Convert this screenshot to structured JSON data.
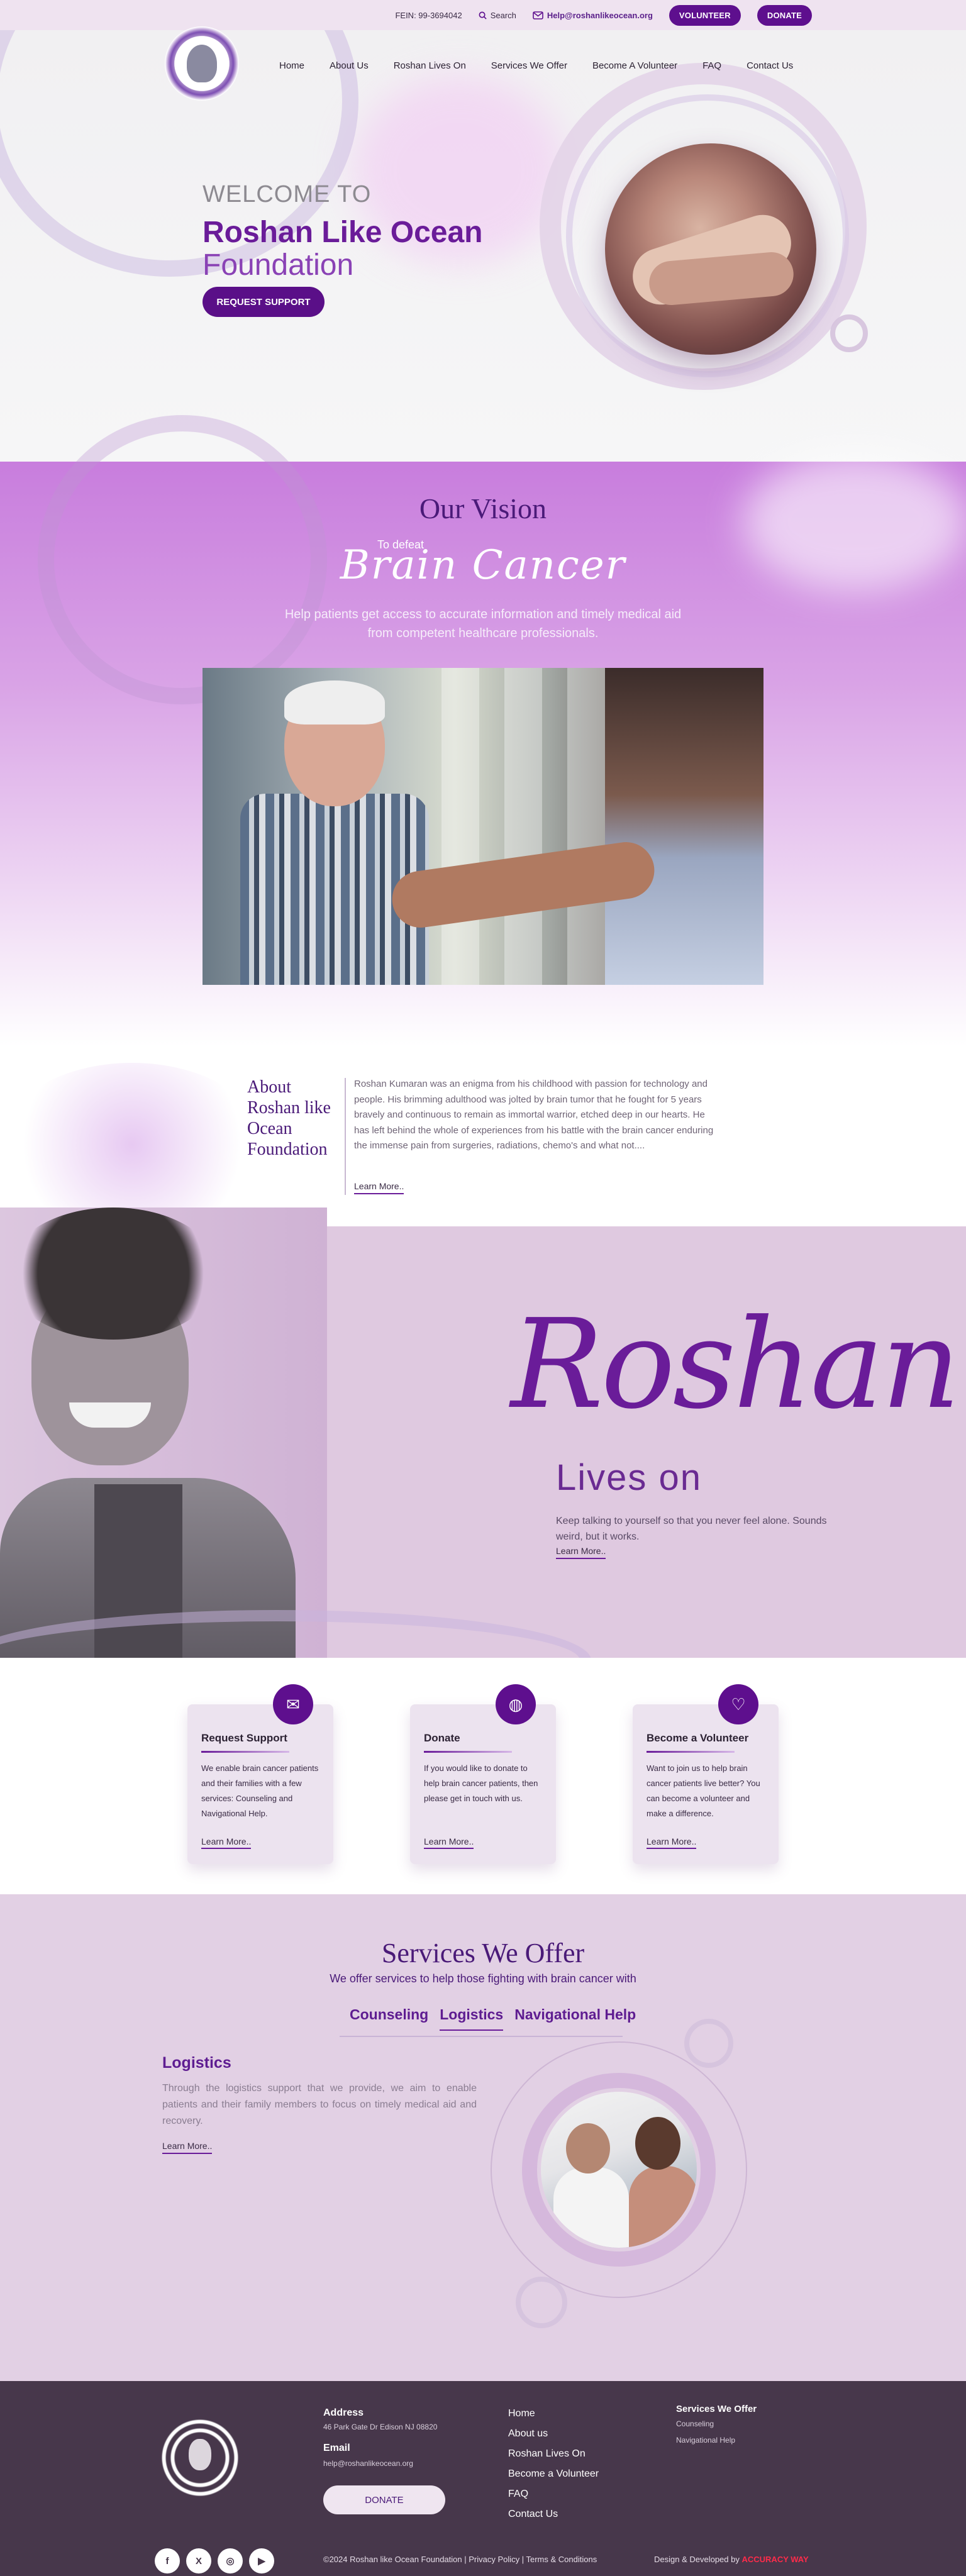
{
  "colors": {
    "brand": "#5e0f8e",
    "accent": "#6a1c99",
    "footer": "#47374b",
    "dev_brand": "#ff2b4a"
  },
  "topbar": {
    "fein": "FEIN: 99-3694042",
    "search": "Search",
    "email": "Help@roshanlikeocean.org",
    "volunteer": "VOLUNTEER",
    "donate": "DONATE"
  },
  "nav": {
    "items": [
      "Home",
      "About Us",
      "Roshan Lives On",
      "Services We Offer",
      "Become A Volunteer",
      "FAQ",
      "Contact Us"
    ]
  },
  "hero": {
    "kicker": "WELCOME TO",
    "title_line1": "Roshan Like Ocean",
    "title_line2": "Foundation",
    "button": "REQUEST SUPPORT"
  },
  "vision": {
    "title": "Our Vision",
    "pre": "To defeat",
    "script": "Brain Cancer",
    "subtitle": "Help patients get access to accurate information and timely medical aid from competent healthcare professionals."
  },
  "about": {
    "title": "About Roshan like Ocean Foundation",
    "text": "Roshan Kumaran was an enigma from his childhood with passion for technology and people. His brimming adulthood was jolted by brain tumor that he fought for 5 years bravely and continuous to remain as immortal warrior, etched deep in our hearts. He has left behind the whole of experiences from his battle with the brain cancer enduring the immense pain from surgeries, radiations, chemo's and what not....",
    "more": "Learn More.."
  },
  "roshan": {
    "word": "Roshan",
    "lives_on": "Lives on",
    "subtitle": "Keep talking to yourself so that you never feel alone. Sounds weird, but it works.",
    "more": "Learn More.."
  },
  "cards": [
    {
      "title": "Request Support",
      "text": "We enable brain cancer patients and their families with a few services: Counseling and Navigational Help.",
      "more": "Learn More..",
      "icon": "chat-icon"
    },
    {
      "title": "Donate",
      "text": "If you would like to donate to help brain cancer patients, then please get in touch with us.",
      "more": "Learn More..",
      "icon": "globe-icon"
    },
    {
      "title": "Become a Volunteer",
      "text": "Want to join us to help brain cancer patients live better? You can become a volunteer and make a difference.",
      "more": "Learn More..",
      "icon": "heart-hand-icon"
    }
  ],
  "services": {
    "title": "Services We Offer",
    "subtitle": "We offer services to help those fighting with brain cancer with",
    "tabs": [
      "Counseling",
      "Logistics",
      "Navigational Help"
    ],
    "active_tab": "Logistics",
    "heading": "Logistics",
    "text": "Through the logistics support that we provide, we aim to enable patients and their family members to focus on timely medical aid and recovery.",
    "more": "Learn More.."
  },
  "footer": {
    "address_label": "Address",
    "address": "46 Park Gate Dr Edison NJ 08820",
    "email_label": "Email",
    "email": "help@roshanlikeocean.org",
    "donate": "DONATE",
    "quick_links": [
      "Home",
      "About us",
      "Roshan Lives On",
      "Become a Volunteer",
      "FAQ",
      "Contact Us"
    ],
    "services_label": "Services We Offer",
    "services": [
      "Counseling",
      "Navigational Help"
    ],
    "social": [
      "f",
      "X",
      "◎",
      "▶"
    ],
    "social_icons": [
      "facebook-icon",
      "x-icon",
      "instagram-icon",
      "youtube-icon"
    ],
    "copyright": "©2024 Roshan like Ocean Foundation | Privacy Policy | Terms & Conditions",
    "dev_prefix": "Design & Developed by",
    "dev_brand": "ACCURACY WAY"
  }
}
